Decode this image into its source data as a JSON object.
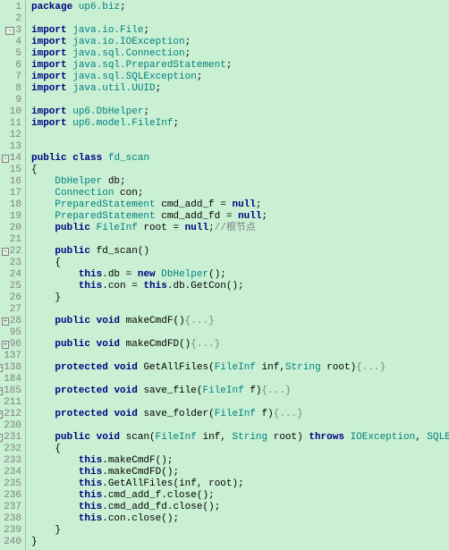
{
  "line_numbers": [
    "1",
    "2",
    "3",
    "4",
    "5",
    "6",
    "7",
    "8",
    "9",
    "10",
    "11",
    "12",
    "13",
    "14",
    "15",
    "16",
    "17",
    "18",
    "19",
    "20",
    "21",
    "22",
    "23",
    "24",
    "25",
    "26",
    "27",
    "28",
    "95",
    "96",
    "137",
    "138",
    "184",
    "185",
    "211",
    "212",
    "230",
    "231",
    "232",
    "233",
    "234",
    "235",
    "236",
    "237",
    "238",
    "239",
    "240"
  ],
  "fold_markers": {
    "3": "-",
    "14": "-",
    "22": "-",
    "28": "+",
    "96": "+",
    "138": "+",
    "185": "+",
    "212": "+",
    "231": "-"
  },
  "tokens": {
    "package": "package",
    "import": "import",
    "public": "public",
    "class": "class",
    "new": "new",
    "null": "null",
    "void": "void",
    "protected": "protected",
    "throws": "throws",
    "this": "this",
    "pkg_up6biz": "up6.biz",
    "pkg_File": "java.io.File",
    "pkg_IOException": "java.io.IOException",
    "pkg_Connection": "java.sql.Connection",
    "pkg_PreparedStatement": "java.sql.PreparedStatement",
    "pkg_SQLException": "java.sql.SQLException",
    "pkg_UUID": "java.util.UUID",
    "pkg_DbHelper": "up6.DbHelper",
    "pkg_FileInf": "up6.model.FileInf",
    "cls_fd_scan": "fd_scan",
    "t_DbHelper": "DbHelper",
    "t_Connection": "Connection",
    "t_PreparedStatement": "PreparedStatement",
    "t_FileInf": "FileInf",
    "t_String": "String",
    "t_IOException": "IOException",
    "t_SQLException": "SQLException",
    "v_db": "db",
    "v_con": "con",
    "v_cmd_add_f": "cmd_add_f",
    "v_cmd_add_fd": "cmd_add_fd",
    "v_root": "root",
    "v_inf": "inf",
    "v_f": "f",
    "m_fd_scan": "fd_scan",
    "m_makeCmdF": "makeCmdF",
    "m_makeCmdFD": "makeCmdFD",
    "m_GetAllFiles": "GetAllFiles",
    "m_save_file": "save_file",
    "m_save_folder": "save_folder",
    "m_scan": "scan",
    "m_GetCon": "GetCon",
    "m_close": "close",
    "comment_root": "//根节点",
    "collapsed": "{...}",
    "semi": ";",
    "eq": " = ",
    "lp": "(",
    "rp": ")",
    "lb": "{",
    "rb": "}",
    "comma": ",",
    "dot": ".",
    "sp": " "
  }
}
